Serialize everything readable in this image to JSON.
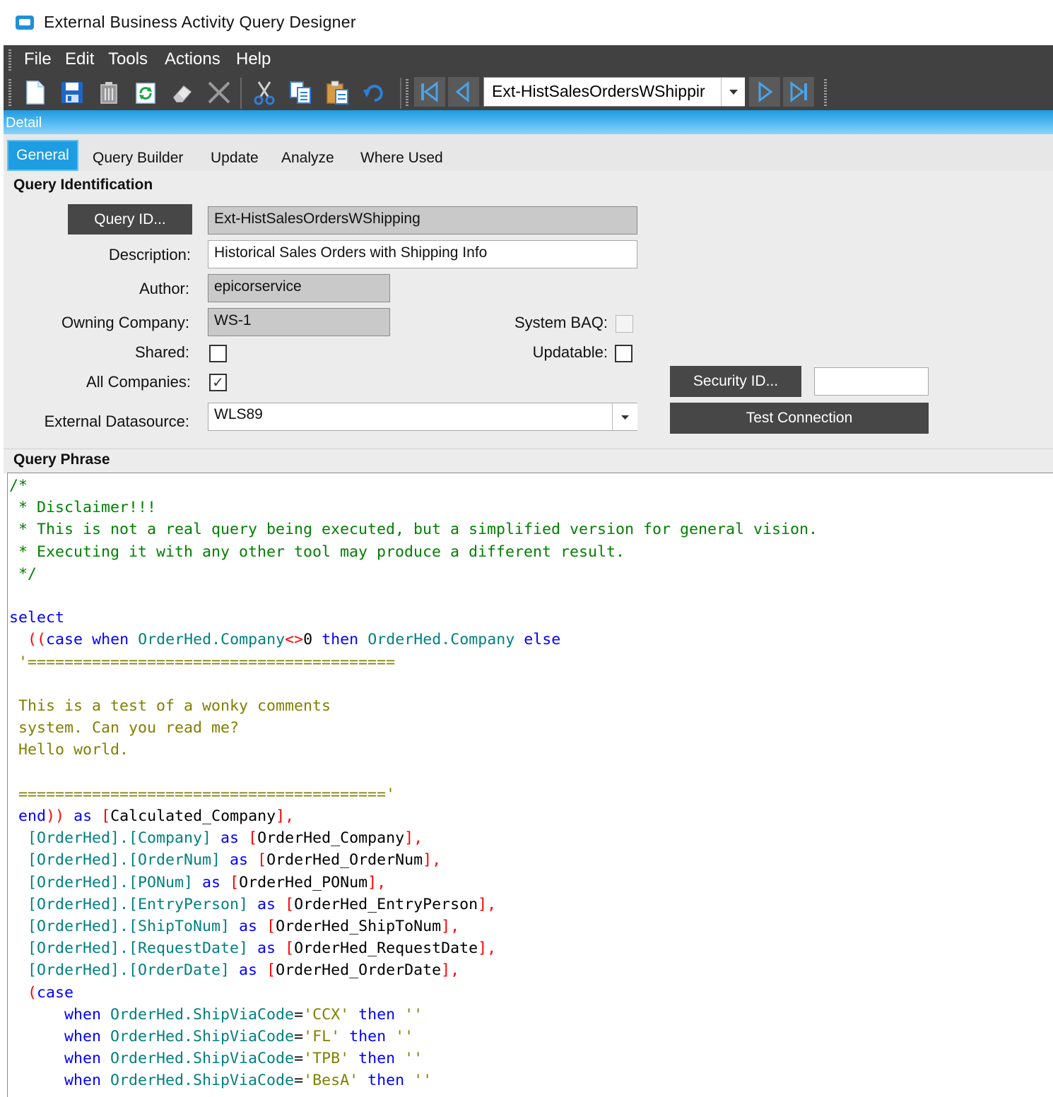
{
  "window": {
    "title": "External Business Activity Query Designer"
  },
  "menu": [
    "File",
    "Edit",
    "Tools",
    "Actions",
    "Help"
  ],
  "toolbar": {
    "icons": [
      "new-icon",
      "save-icon",
      "delete-icon",
      "refresh-icon",
      "clear-icon",
      "cancel-icon",
      "cut-icon",
      "copy-icon",
      "paste-icon",
      "undo-icon",
      "first-record-icon",
      "previous-record-icon",
      "next-record-icon",
      "last-record-icon"
    ],
    "navigator_value": "Ext-HistSalesOrdersWShippir"
  },
  "panel": {
    "title": "Detail"
  },
  "tabs": [
    "General",
    "Query Builder",
    "Update",
    "Analyze",
    "Where Used"
  ],
  "identification": {
    "section_title": "Query Identification",
    "query_id_button": "Query ID...",
    "query_id_value": "Ext-HistSalesOrdersWShipping",
    "description_label": "Description:",
    "description_value": "Historical Sales Orders with Shipping Info",
    "author_label": "Author:",
    "author_value": "epicorservice",
    "owning_company_label": "Owning Company:",
    "owning_company_value": "WS-1",
    "system_baq_label": "System BAQ:",
    "system_baq_checked": false,
    "shared_label": "Shared:",
    "shared_checked": false,
    "updatable_label": "Updatable:",
    "updatable_checked": false,
    "all_companies_label": "All Companies:",
    "all_companies_checked": true,
    "all_companies_mark": "✓",
    "security_id_button": "Security ID...",
    "security_id_value": "",
    "external_datasource_label": "External Datasource:",
    "external_datasource_value": "WLS89",
    "test_connection_button": "Test Connection"
  },
  "phrase": {
    "section_title": "Query Phrase",
    "lines": [
      [
        [
          "c",
          "/*"
        ]
      ],
      [
        [
          "c",
          " * Disclaimer!!!"
        ]
      ],
      [
        [
          "c",
          " * This is not a real query being executed, but a simplified version for general vision."
        ]
      ],
      [
        [
          "c",
          " * Executing it with any other tool may produce a different result."
        ]
      ],
      [
        [
          "c",
          " */"
        ]
      ],
      [],
      [
        [
          "k",
          "select"
        ]
      ],
      [
        [
          "t",
          "  "
        ],
        [
          "p",
          "(("
        ],
        [
          "k",
          "case"
        ],
        [
          "t",
          " "
        ],
        [
          "k",
          "when"
        ],
        [
          "t",
          " "
        ],
        [
          "i",
          "OrderHed.Company"
        ],
        [
          "p",
          "<>"
        ],
        [
          "n",
          "0"
        ],
        [
          "t",
          " "
        ],
        [
          "k",
          "then"
        ],
        [
          "t",
          " "
        ],
        [
          "i",
          "OrderHed.Company"
        ],
        [
          "t",
          " "
        ],
        [
          "k",
          "else"
        ]
      ],
      [
        [
          "t",
          " "
        ],
        [
          "s",
          "'========================================"
        ]
      ],
      [],
      [
        [
          "s",
          " This is a test of a wonky comments"
        ]
      ],
      [
        [
          "s",
          " system. Can you read me?"
        ]
      ],
      [
        [
          "s",
          " Hello world."
        ]
      ],
      [],
      [
        [
          "s",
          " ========================================'"
        ]
      ],
      [
        [
          "t",
          " "
        ],
        [
          "k",
          "end"
        ],
        [
          "p",
          "))"
        ],
        [
          "t",
          " "
        ],
        [
          "k",
          "as"
        ],
        [
          "t",
          " "
        ],
        [
          "p",
          "["
        ],
        [
          "t",
          "Calculated_Company"
        ],
        [
          "p",
          "],"
        ]
      ],
      [
        [
          "t",
          "  "
        ],
        [
          "i",
          "[OrderHed].[Company]"
        ],
        [
          "t",
          " "
        ],
        [
          "k",
          "as"
        ],
        [
          "t",
          " "
        ],
        [
          "p",
          "["
        ],
        [
          "t",
          "OrderHed_Company"
        ],
        [
          "p",
          "],"
        ]
      ],
      [
        [
          "t",
          "  "
        ],
        [
          "i",
          "[OrderHed].[OrderNum]"
        ],
        [
          "t",
          " "
        ],
        [
          "k",
          "as"
        ],
        [
          "t",
          " "
        ],
        [
          "p",
          "["
        ],
        [
          "t",
          "OrderHed_OrderNum"
        ],
        [
          "p",
          "],"
        ]
      ],
      [
        [
          "t",
          "  "
        ],
        [
          "i",
          "[OrderHed].[PONum]"
        ],
        [
          "t",
          " "
        ],
        [
          "k",
          "as"
        ],
        [
          "t",
          " "
        ],
        [
          "p",
          "["
        ],
        [
          "t",
          "OrderHed_PONum"
        ],
        [
          "p",
          "],"
        ]
      ],
      [
        [
          "t",
          "  "
        ],
        [
          "i",
          "[OrderHed].[EntryPerson]"
        ],
        [
          "t",
          " "
        ],
        [
          "k",
          "as"
        ],
        [
          "t",
          " "
        ],
        [
          "p",
          "["
        ],
        [
          "t",
          "OrderHed_EntryPerson"
        ],
        [
          "p",
          "],"
        ]
      ],
      [
        [
          "t",
          "  "
        ],
        [
          "i",
          "[OrderHed].[ShipToNum]"
        ],
        [
          "t",
          " "
        ],
        [
          "k",
          "as"
        ],
        [
          "t",
          " "
        ],
        [
          "p",
          "["
        ],
        [
          "t",
          "OrderHed_ShipToNum"
        ],
        [
          "p",
          "],"
        ]
      ],
      [
        [
          "t",
          "  "
        ],
        [
          "i",
          "[OrderHed].[RequestDate]"
        ],
        [
          "t",
          " "
        ],
        [
          "k",
          "as"
        ],
        [
          "t",
          " "
        ],
        [
          "p",
          "["
        ],
        [
          "t",
          "OrderHed_RequestDate"
        ],
        [
          "p",
          "],"
        ]
      ],
      [
        [
          "t",
          "  "
        ],
        [
          "i",
          "[OrderHed].[OrderDate]"
        ],
        [
          "t",
          " "
        ],
        [
          "k",
          "as"
        ],
        [
          "t",
          " "
        ],
        [
          "p",
          "["
        ],
        [
          "t",
          "OrderHed_OrderDate"
        ],
        [
          "p",
          "],"
        ]
      ],
      [
        [
          "t",
          "  "
        ],
        [
          "p",
          "("
        ],
        [
          "k",
          "case"
        ]
      ],
      [
        [
          "t",
          "      "
        ],
        [
          "k",
          "when"
        ],
        [
          "t",
          " "
        ],
        [
          "i",
          "OrderHed.ShipViaCode"
        ],
        [
          "t",
          "="
        ],
        [
          "s",
          "'CCX'"
        ],
        [
          "t",
          " "
        ],
        [
          "k",
          "then"
        ],
        [
          "t",
          " "
        ],
        [
          "s",
          "''"
        ]
      ],
      [
        [
          "t",
          "      "
        ],
        [
          "k",
          "when"
        ],
        [
          "t",
          " "
        ],
        [
          "i",
          "OrderHed.ShipViaCode"
        ],
        [
          "t",
          "="
        ],
        [
          "s",
          "'FL'"
        ],
        [
          "t",
          " "
        ],
        [
          "k",
          "then"
        ],
        [
          "t",
          " "
        ],
        [
          "s",
          "''"
        ]
      ],
      [
        [
          "t",
          "      "
        ],
        [
          "k",
          "when"
        ],
        [
          "t",
          " "
        ],
        [
          "i",
          "OrderHed.ShipViaCode"
        ],
        [
          "t",
          "="
        ],
        [
          "s",
          "'TPB'"
        ],
        [
          "t",
          " "
        ],
        [
          "k",
          "then"
        ],
        [
          "t",
          " "
        ],
        [
          "s",
          "''"
        ]
      ],
      [
        [
          "t",
          "      "
        ],
        [
          "k",
          "when"
        ],
        [
          "t",
          " "
        ],
        [
          "i",
          "OrderHed.ShipViaCode"
        ],
        [
          "t",
          "="
        ],
        [
          "s",
          "'BesA'"
        ],
        [
          "t",
          " "
        ],
        [
          "k",
          "then"
        ],
        [
          "t",
          " "
        ],
        [
          "s",
          "''"
        ]
      ]
    ]
  },
  "colors": {
    "comment": "#008000",
    "keyword": "#0000ff",
    "identifier": "#008080",
    "punctuation": "#ff0000",
    "string": "#808000",
    "text": "#000000",
    "accent": "#1e9de2",
    "toolbar_bg": "#414141"
  }
}
